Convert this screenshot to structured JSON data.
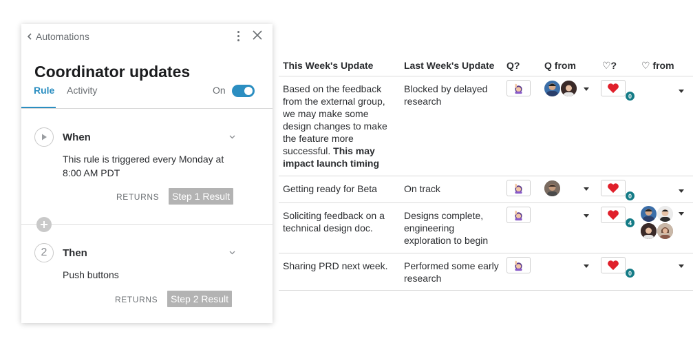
{
  "panel": {
    "back_label": "Automations",
    "title": "Coordinator updates",
    "tabs": {
      "rule": "Rule",
      "activity": "Activity"
    },
    "toggle_label": "On",
    "toggle_on": true,
    "accent_color": "#2b8ec1",
    "steps": [
      {
        "marker": "play-icon",
        "label": "When",
        "description": "This rule is triggered every Monday at 8:00 AM PDT",
        "returns_label": "RETURNS",
        "result_label": "Step 1 Result"
      },
      {
        "marker": "2",
        "label": "Then",
        "description": "Push buttons",
        "returns_label": "RETURNS",
        "result_label": "Step 2 Result"
      }
    ]
  },
  "table": {
    "headers": {
      "this_week": "This Week's Update",
      "last_week": "Last Week's Update",
      "q": "Q?",
      "q_from": "Q from",
      "heart": "♡?",
      "heart_from": "♡ from"
    },
    "rows": [
      {
        "this_week": "Based on the feedback from the external group, we may make some design changes to make the feature more successful.",
        "this_week_bold": "This may impact launch timing",
        "last_week": "Blocked by delayed research",
        "heart_count": "0"
      },
      {
        "this_week": "Getting ready for Beta",
        "last_week": "On track",
        "heart_count": "0"
      },
      {
        "this_week": "Soliciting feedback on a technical design doc.",
        "last_week": "Designs complete, engineering exploration to begin",
        "heart_count": "4"
      },
      {
        "this_week": "Sharing PRD next week.",
        "last_week": "Performed some early research",
        "heart_count": "0"
      }
    ]
  },
  "icons": {
    "question_emoji": "woman-raising-hand-icon",
    "heart_emoji": "red-heart-icon"
  },
  "colors": {
    "badge": "#147b86",
    "heart": "#e0202b",
    "pill": "#b3b3b3"
  }
}
